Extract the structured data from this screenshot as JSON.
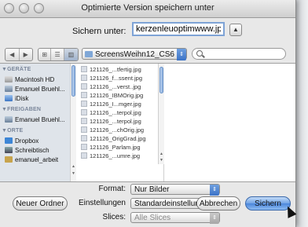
{
  "window": {
    "title": "Optimierte Version speichern unter"
  },
  "save": {
    "label": "Sichern unter:",
    "filename": "kerzenleuoptimwww.jpg",
    "expand_arrow": "▲"
  },
  "toolbar": {
    "back_arrow": "◀",
    "forward_arrow": "▶",
    "view_icons": "⊞",
    "view_list": "☰",
    "view_columns": "▥",
    "folder": "ScreensWeihn12_CS6",
    "folder_arrows": "⇕"
  },
  "sidebar": {
    "sections": [
      {
        "heading": "GERÄTE",
        "items": [
          {
            "label": "Macintosh HD",
            "icon": "hard-drive-icon"
          },
          {
            "label": "Emanuel Bruehl...",
            "icon": "network-computer-icon"
          },
          {
            "label": "iDisk",
            "icon": "idisk-icon"
          }
        ]
      },
      {
        "heading": "FREIGABEN",
        "items": [
          {
            "label": "Emanuel Bruehl...",
            "icon": "shared-computer-icon"
          }
        ]
      },
      {
        "heading": "ORTE",
        "items": [
          {
            "label": "Dropbox",
            "icon": "dropbox-icon"
          },
          {
            "label": "Schreibtisch",
            "icon": "desktop-icon"
          },
          {
            "label": "emanuel_arbeit",
            "icon": "home-icon"
          }
        ]
      }
    ],
    "heading_triangle": "▼"
  },
  "files": [
    "121126_...tfertig.jpg",
    "121126_f...ssent.jpg",
    "121126_...verst..jpg",
    "121126_IBMOrig.jpg",
    "121126_I...mger.jpg",
    "121126_...terpol.jpg",
    "121126_...terpol.jpg",
    "121126_...chOrig.jpg",
    "121126_OrigGrad.jpg",
    "121126_Parlam.jpg",
    "121126_...umre.jpg"
  ],
  "options": {
    "format_label": "Format:",
    "format_value": "Nur Bilder",
    "settings_label": "Einstellungen",
    "settings_value": "Standardeinstellungen",
    "slices_label": "Slices:",
    "slices_value": "Alle Slices",
    "popup_arrows": "⇕"
  },
  "buttons": {
    "new_folder": "Neuer Ordner",
    "cancel": "Abbrechen",
    "save": "Sichern"
  },
  "colors": {
    "accent": "#4b86db",
    "sidebar_bg": "#dfe4ea",
    "dialog_bg": "#e8e8e8"
  }
}
